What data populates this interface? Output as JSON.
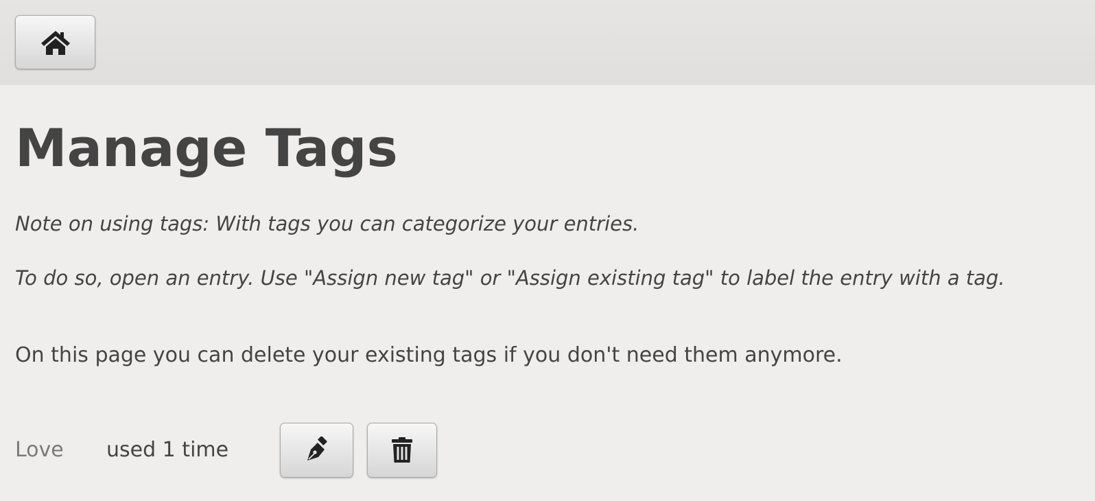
{
  "header": {
    "home_icon": "home-icon"
  },
  "page": {
    "title": "Manage Tags",
    "note_line1": "Note on using tags: With tags you can categorize your entries.",
    "note_line2": "To do so, open an entry. Use \"Assign new tag\" or \"Assign existing tag\" to label the entry with a tag.",
    "info": "On this page you can delete your existing tags if you don't need them anymore."
  },
  "tags": [
    {
      "name": "Love",
      "usage": "used 1 time",
      "edit_icon": "pen-icon",
      "delete_icon": "trash-icon"
    }
  ],
  "colors": {
    "background": "#efeeec",
    "header": "#e3e2e0",
    "text": "#444444",
    "tag_name": "#7a7a7a"
  }
}
